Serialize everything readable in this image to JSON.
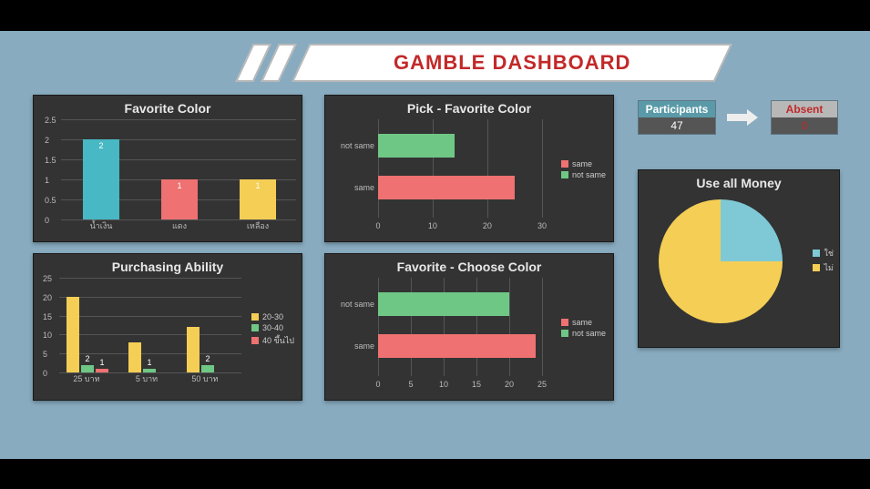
{
  "title": "GAMBLE DASHBOARD",
  "colors": {
    "teal": "#47b8c4",
    "red": "#ef7171",
    "yellow": "#f4ce55",
    "green": "#6fc785"
  },
  "favorite_color": {
    "title": "Favorite Color",
    "y_ticks": [
      "0",
      "0.5",
      "1",
      "1.5",
      "2",
      "2.5"
    ],
    "categories": [
      "น้ำเงิน",
      "แดง",
      "เหลือง"
    ]
  },
  "purchasing": {
    "title": "Purchasing Ability",
    "y_ticks": [
      "0",
      "5",
      "10",
      "15",
      "20",
      "25"
    ],
    "categories": [
      "25 บาท",
      "5 บาท",
      "50 บาท"
    ],
    "legend": [
      "20-30",
      "30-40",
      "40 ขึ้นไป"
    ]
  },
  "pick_fav": {
    "title": "Pick - Favorite Color",
    "x_ticks": [
      "0",
      "10",
      "20",
      "30"
    ],
    "y_cats": [
      "not same",
      "same"
    ],
    "legend": [
      "same",
      "not same"
    ]
  },
  "fav_choose": {
    "title": "Favorite - Choose Color",
    "x_ticks": [
      "0",
      "5",
      "10",
      "15",
      "20",
      "25"
    ],
    "y_cats": [
      "not same",
      "same"
    ],
    "legend": [
      "same",
      "not same"
    ]
  },
  "participants": {
    "label": "Participants",
    "value": "47"
  },
  "absent": {
    "label": "Absent",
    "value": "0"
  },
  "use_money": {
    "title": "Use all Money",
    "legend": [
      "ใช่",
      "ไม่"
    ]
  },
  "chart_data": [
    {
      "type": "bar",
      "title": "Favorite Color",
      "categories": [
        "น้ำเงิน",
        "แดง",
        "เหลือง"
      ],
      "values": [
        2,
        1,
        1
      ],
      "colors": [
        "#47b8c4",
        "#ef7171",
        "#f4ce55"
      ],
      "ylim": [
        0,
        2.5
      ]
    },
    {
      "type": "bar",
      "title": "Purchasing Ability",
      "categories": [
        "25 บาท",
        "5 บาท",
        "50 บาท"
      ],
      "series": [
        {
          "name": "20-30",
          "values": [
            20,
            8,
            12
          ],
          "color": "#f4ce55"
        },
        {
          "name": "30-40",
          "values": [
            2,
            1,
            2
          ],
          "color": "#6fc785"
        },
        {
          "name": "40 ขึ้นไป",
          "values": [
            1,
            0,
            0
          ],
          "color": "#ef7171"
        }
      ],
      "ylim": [
        0,
        25
      ]
    },
    {
      "type": "bar",
      "orientation": "horizontal",
      "title": "Pick - Favorite Color",
      "categories": [
        "not same",
        "same"
      ],
      "values": [
        14,
        25
      ],
      "colors": [
        "#6fc785",
        "#ef7171"
      ],
      "xlim": [
        0,
        30
      ],
      "legend": [
        "same",
        "not same"
      ]
    },
    {
      "type": "bar",
      "orientation": "horizontal",
      "title": "Favorite - Choose Color",
      "categories": [
        "not same",
        "same"
      ],
      "values": [
        20,
        24
      ],
      "colors": [
        "#6fc785",
        "#ef7171"
      ],
      "xlim": [
        0,
        25
      ],
      "legend": [
        "same",
        "not same"
      ]
    },
    {
      "type": "pie",
      "title": "Use all Money",
      "labels": [
        "ใช่",
        "ไม่"
      ],
      "values": [
        25,
        75
      ],
      "colors": [
        "#7fc9d6",
        "#f4ce55"
      ]
    }
  ]
}
